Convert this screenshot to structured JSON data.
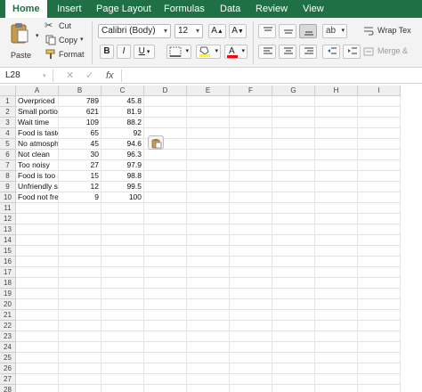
{
  "ribbon_tabs": [
    "Home",
    "Insert",
    "Page Layout",
    "Formulas",
    "Data",
    "Review",
    "View"
  ],
  "clipboard": {
    "paste_label": "Paste",
    "cut_label": "Cut",
    "copy_label": "Copy",
    "format_label": "Format"
  },
  "font": {
    "name": "Calibri (Body)",
    "size": "12",
    "bold": "B",
    "italic": "I",
    "underline": "U",
    "grow": "A",
    "shrink": "A",
    "color_a": "A"
  },
  "alignment": {
    "wrap_text_label": "Wrap Tex",
    "merge_label": "Merge &"
  },
  "formula_bar": {
    "name_box": "L28",
    "fx": "fx",
    "cancel": "✕",
    "confirm": "✓"
  },
  "sheet": {
    "columns": [
      "A",
      "B",
      "C",
      "D",
      "E",
      "F",
      "G",
      "H",
      "I"
    ],
    "rows": [
      [
        "Overpriced",
        "789",
        "45.8"
      ],
      [
        "Small portion",
        "621",
        "81.9"
      ],
      [
        "Wait time",
        "109",
        "88.2"
      ],
      [
        "Food is taste",
        "65",
        "92"
      ],
      [
        "No atmosphe",
        "45",
        "94.6"
      ],
      [
        "Not clean",
        "30",
        "96.3"
      ],
      [
        "Too noisy",
        "27",
        "97.9"
      ],
      [
        "Food is too s",
        "15",
        "98.8"
      ],
      [
        "Unfriendly st",
        "12",
        "99.5"
      ],
      [
        "Food not fres",
        "9",
        "100"
      ]
    ],
    "row_numbers": [
      "1",
      "2",
      "3",
      "4",
      "5",
      "6",
      "7",
      "8",
      "9",
      "10",
      "11",
      "12",
      "13",
      "14",
      "15",
      "16",
      "17",
      "18",
      "19",
      "20",
      "21",
      "22",
      "23",
      "24",
      "25",
      "26",
      "27",
      "28"
    ]
  },
  "colors": {
    "ribbon_green": "#1f7145",
    "highlight_yellow": "#ffff00",
    "font_red": "#ff0000"
  }
}
